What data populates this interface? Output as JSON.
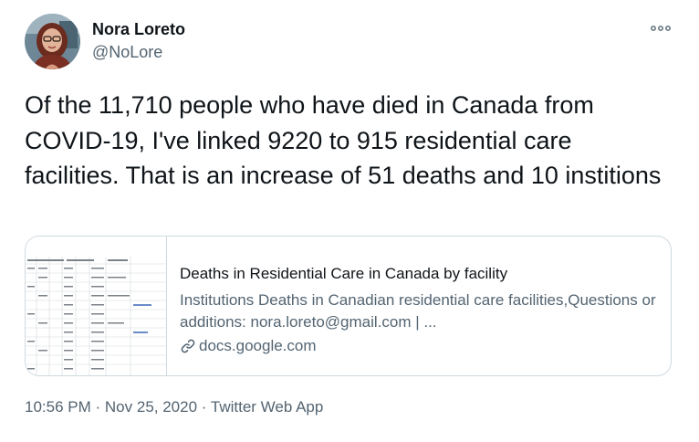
{
  "author": {
    "display_name": "Nora Loreto",
    "handle": "@NoLore",
    "avatar_icon": "profile-photo"
  },
  "tweet": {
    "text": "Of the 11,710 people who have died in Canada from COVID-19, I've linked 9220 to 915 residential care facilities. That is an increase of 51 deaths and 10 institions"
  },
  "card": {
    "title": "Deaths in Residential Care in Canada by facility",
    "description": "Institutions Deaths in Canadian residential care facilities,Questions or additions: nora.loreto@gmail.com | ...",
    "domain": "docs.google.com",
    "thumbnail_icon": "spreadsheet-thumbnail"
  },
  "meta": {
    "time": "10:56 PM",
    "separator": "·",
    "date": "Nov 25, 2020",
    "source": "Twitter Web App"
  },
  "colors": {
    "text": "#0f1419",
    "secondary": "#536471",
    "border": "#cfd9de"
  }
}
